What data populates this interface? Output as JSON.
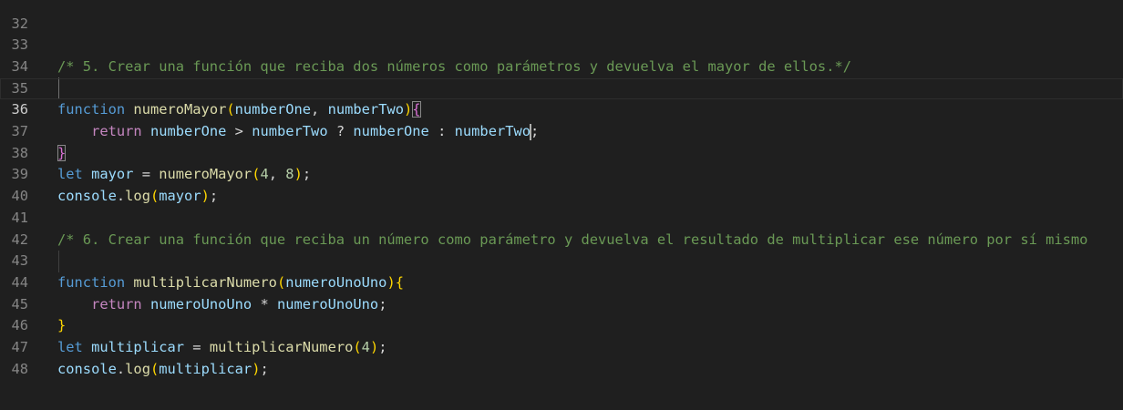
{
  "editor": {
    "line_numbers": [
      "32",
      "33",
      "34",
      "35",
      "36",
      "37",
      "38",
      "39",
      "40",
      "41",
      "42",
      "43",
      "44",
      "45",
      "46",
      "47",
      "48"
    ],
    "comment_5": "/* 5. Crear una función que reciba dos números como parámetros y devuelva el mayor de ellos.*/",
    "comment_6": "/* 6. Crear una función que reciba un número como parámetro y devuelva el resultado de multiplicar ese número por sí mismo",
    "kw_function": "function",
    "kw_return": "return",
    "kw_let": "let",
    "fn_numeroMayor": "numeroMayor",
    "fn_multiplicarNumero": "multiplicarNumero",
    "fn_log": "log",
    "param_numberOne": "numberOne",
    "param_numberTwo": "numberTwo",
    "param_numeroUnoUno": "numeroUnoUno",
    "var_mayor": "mayor",
    "var_multiplicar": "multiplicar",
    "obj_console": "console",
    "num_4": "4",
    "num_8": "8"
  }
}
